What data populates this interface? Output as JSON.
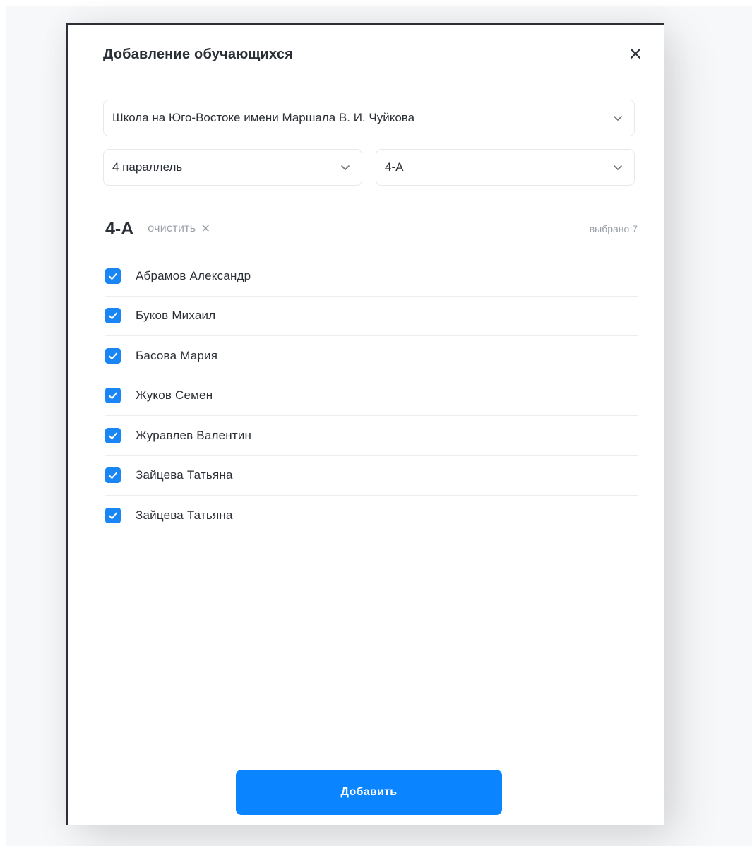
{
  "modal": {
    "title": "Добавление обучающихся",
    "close_icon": "close-icon"
  },
  "filters": {
    "school": "Школа на Юго-Востоке имени Маршала В. И. Чуйкова",
    "parallel": "4 параллель",
    "class": "4-А"
  },
  "group": {
    "title": "4-А",
    "clear_label": "очистить",
    "clear_icon": "✕",
    "selected_count": "выбрано 7"
  },
  "students": [
    {
      "name": "Абрамов Александр",
      "checked": true
    },
    {
      "name": "Буков Михаил",
      "checked": true
    },
    {
      "name": "Басова Мария",
      "checked": true
    },
    {
      "name": "Жуков Семен",
      "checked": true
    },
    {
      "name": "Журавлев Валентин",
      "checked": true
    },
    {
      "name": "Зайцева Татьяна",
      "checked": true
    },
    {
      "name": "Зайцева Татьяна",
      "checked": true
    }
  ],
  "actions": {
    "add_label": "Добавить"
  },
  "colors": {
    "accent": "#0a84ff",
    "checkbox": "#1a86f5",
    "muted_text": "#9aa0a8"
  }
}
